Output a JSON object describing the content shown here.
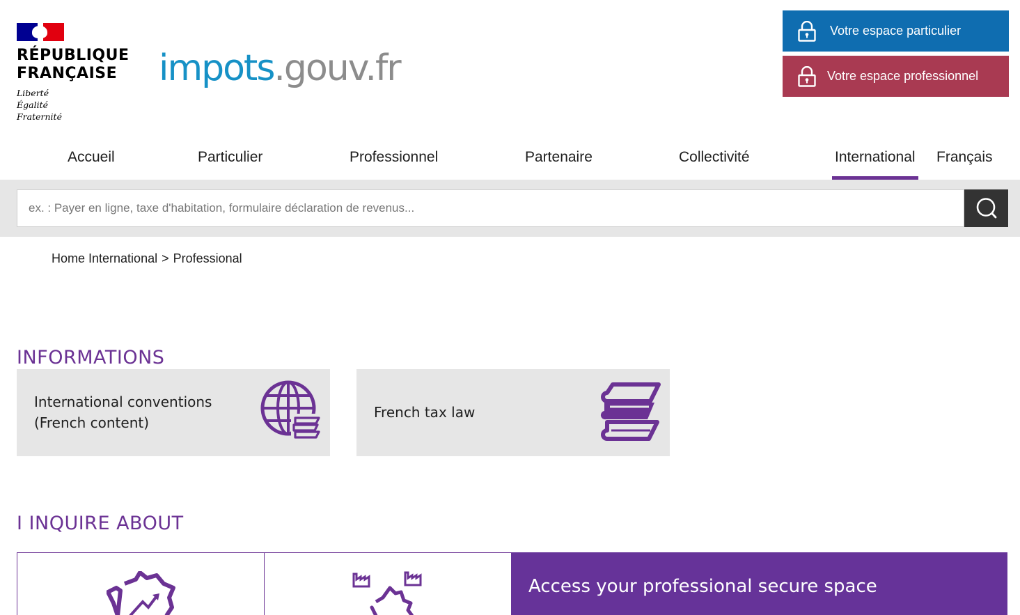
{
  "header": {
    "rf_name_line1": "RÉPUBLIQUE",
    "rf_name_line2": "FRANÇAISE",
    "rf_motto_1": "Liberté",
    "rf_motto_2": "Égalité",
    "rf_motto_3": "Fraternité",
    "site_logo_part1": "impots",
    "site_logo_part2": ".gouv.fr",
    "btn_particulier": "Votre espace particulier",
    "btn_professionnel": "Votre espace professionnel",
    "colors": {
      "particulier": "#0f6db0",
      "professionnel": "#a93a52",
      "accent": "#6b3294"
    }
  },
  "nav": {
    "items": [
      "Accueil",
      "Particulier",
      "Professionnel",
      "Partenaire",
      "Collectivité",
      "International"
    ],
    "active": "International",
    "language": "Français"
  },
  "search": {
    "placeholder": "ex. : Payer en ligne, taxe d'habitation, formulaire déclaration de revenus...",
    "value": ""
  },
  "breadcrumb": {
    "home": "Home International",
    "separator": ">",
    "current": "Professional"
  },
  "informations": {
    "title": "INFORMATIONS",
    "cards": [
      {
        "label_line1": "International conventions",
        "label_line2": "(French content)",
        "icon": "globe-books-icon"
      },
      {
        "label_line1": "French tax law",
        "icon": "books-stack-icon"
      }
    ]
  },
  "inquire": {
    "title": "I INQUIRE ABOUT",
    "tiles": [
      {
        "icon": "france-map-growth-icon"
      },
      {
        "icon": "france-map-factories-icon"
      },
      {
        "label": "Access your professional secure space"
      }
    ]
  }
}
